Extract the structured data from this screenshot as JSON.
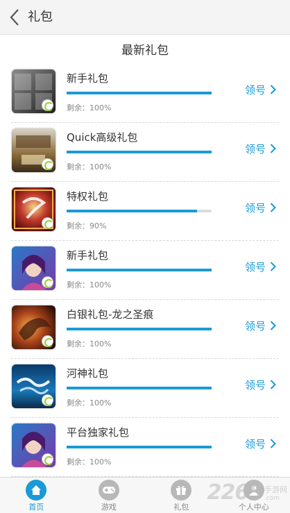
{
  "header": {
    "title": "礼包",
    "back_icon": "chevron-left-icon"
  },
  "section": {
    "title": "最新礼包"
  },
  "gifts": [
    {
      "name": "新手礼包",
      "remain": "剩余：100%",
      "progress": 1.0,
      "action": "领号",
      "icon": "game-icon-bashi"
    },
    {
      "name": "Quick高级礼包",
      "remain": "剩余：100%",
      "progress": 1.0,
      "action": "领号",
      "icon": "game-icon-sanguozhi"
    },
    {
      "name": "特权礼包",
      "remain": "剩余：90%",
      "progress": 0.9,
      "action": "领号",
      "icon": "game-icon-wendao"
    },
    {
      "name": "新手礼包",
      "remain": "剩余：100%",
      "progress": 1.0,
      "action": "领号",
      "icon": "game-icon-heroine"
    },
    {
      "name": "白银礼包-龙之圣痕",
      "remain": "剩余：100%",
      "progress": 1.0,
      "action": "领号",
      "icon": "game-icon-dragon"
    },
    {
      "name": "河神礼包",
      "remain": "剩余：100%",
      "progress": 1.0,
      "action": "领号",
      "icon": "game-icon-heshen"
    },
    {
      "name": "平台独家礼包",
      "remain": "剩余：100%",
      "progress": 1.0,
      "action": "领号",
      "icon": "game-icon-heroine"
    }
  ],
  "tabbar": {
    "tabs": [
      {
        "label": "首页",
        "icon": "home-icon",
        "active": true
      },
      {
        "label": "游戏",
        "icon": "gamepad-icon",
        "active": false
      },
      {
        "label": "礼包",
        "icon": "gift-icon",
        "active": false
      },
      {
        "label": "个人中心",
        "icon": "user-icon",
        "active": false
      }
    ]
  },
  "watermark": {
    "number": "2265",
    "site": "手游网",
    "domain": ".com"
  },
  "colors": {
    "accent": "#1a9ad6",
    "track": "#dddddd",
    "header_bg": "#f4f4f4"
  }
}
